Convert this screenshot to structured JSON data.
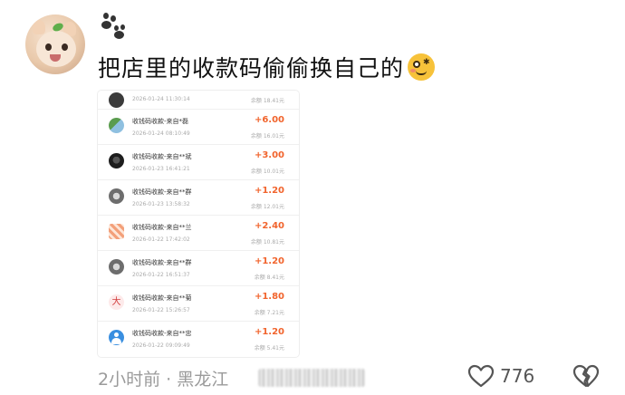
{
  "post": {
    "text": "把店里的收款码偷偷换自己的",
    "emoji_icon": "woozy-face-emoji",
    "location_line": "2小时前 · 黑龙江",
    "like_count": "776"
  },
  "transactions": [
    {
      "title": "",
      "time": "2026-01-24 11:30:14",
      "amount": "",
      "balance": "余额 18.41元",
      "icon": "dark-avatar"
    },
    {
      "title": "收钱码收款-来自*磊",
      "time": "2026-01-24 08:10:49",
      "amount": "+6.00",
      "balance": "余额 16.01元",
      "icon": "landscape-avatar"
    },
    {
      "title": "收钱码收款-来自**斌",
      "time": "2026-01-23 16:41:21",
      "amount": "+3.00",
      "balance": "余额 10.01元",
      "icon": "dark-dog-avatar"
    },
    {
      "title": "收钱码收款-来自**群",
      "time": "2026-01-23 13:58:32",
      "amount": "+1.20",
      "balance": "余额 12.01元",
      "icon": "gray-dog-avatar"
    },
    {
      "title": "收钱码收款-来自**兰",
      "time": "2026-01-22 17:42:02",
      "amount": "+2.40",
      "balance": "余额 10.81元",
      "icon": "orange-pattern-avatar"
    },
    {
      "title": "收钱码收款-来自**群",
      "time": "2026-01-22 16:51:37",
      "amount": "+1.20",
      "balance": "余额 8.41元",
      "icon": "gray-dog-avatar"
    },
    {
      "title": "收钱码收款-来自**菊",
      "time": "2026-01-22 15:26:57",
      "amount": "+1.80",
      "balance": "余额 7.21元",
      "icon": "red-character-avatar"
    },
    {
      "title": "收钱码收款-来自**忠",
      "time": "2026-01-22 09:09:49",
      "amount": "+1.20",
      "balance": "余额 5.41元",
      "icon": "default-user-avatar"
    }
  ],
  "icon_chars": {
    "red_character": "大"
  },
  "colors": {
    "amount": "#f1642d",
    "meta": "#9b9b9b"
  }
}
